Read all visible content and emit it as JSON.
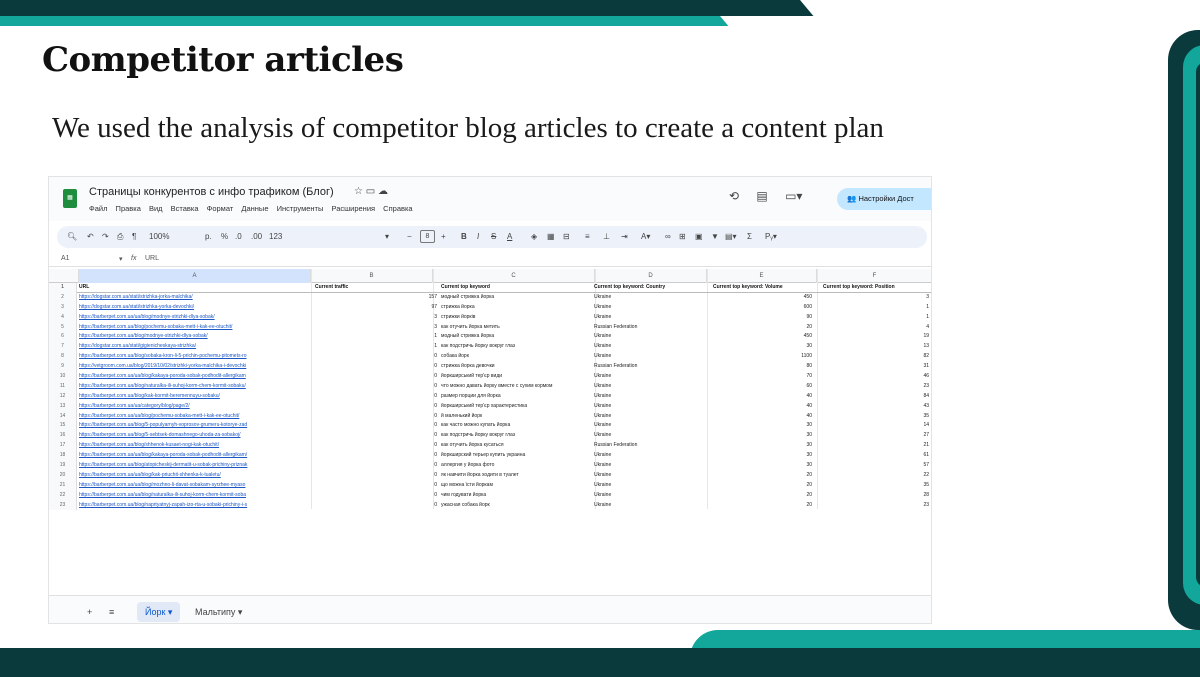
{
  "slide": {
    "title": "Competitor articles",
    "subtitle": "We used the analysis of competitor blog articles to create a content plan"
  },
  "sheet": {
    "doc_title": "Страницы конкурентов с инфо трафиком (Блог)",
    "menu": [
      "Файл",
      "Правка",
      "Вид",
      "Вставка",
      "Формат",
      "Данные",
      "Инструменты",
      "Расширения",
      "Справка"
    ],
    "share_label": "Настройки Дост",
    "zoom": "100%",
    "font_size": "8",
    "cell_ref": "A1",
    "formula": "URL",
    "col_letters": [
      "A",
      "B",
      "C",
      "D",
      "E",
      "F"
    ],
    "headers": [
      "URL",
      "Current traffic",
      "Current top keyword",
      "Current top keyword: Country",
      "Current top keyword: Volume",
      "Current top keyword: Position"
    ],
    "rows": [
      {
        "n": "2",
        "url": "https://dogstar.com.ua/stati/strizhka-jorka-malchika/",
        "traffic": "157",
        "kw": "модный стрижка йорка",
        "country": "Ukraine",
        "vol": "450",
        "pos": "3"
      },
      {
        "n": "3",
        "url": "https://dogstar.com.ua/stati/strizhka-yorka-devochki/",
        "traffic": "97",
        "kw": "стрижка йорка",
        "country": "Ukraine",
        "vol": "600",
        "pos": "1"
      },
      {
        "n": "4",
        "url": "https://barberpet.com.ua/ua/blog/modnye-strizhki-dlya-sobak/",
        "traffic": "3",
        "kw": "стрижки йорків",
        "country": "Ukraine",
        "vol": "90",
        "pos": "1"
      },
      {
        "n": "5",
        "url": "https://barberpet.com.ua/blog/pochemu-sobaka-mett-i-kak-ee-otuchit/",
        "traffic": "3",
        "kw": "как отучить йорка метить",
        "country": "Russian Federation",
        "vol": "20",
        "pos": "4"
      },
      {
        "n": "6",
        "url": "https://barberpet.com.ua/blog/modnye-strizhki-dlya-sobak/",
        "traffic": "1",
        "kw": "модный стрижка йорка",
        "country": "Ukraine",
        "vol": "450",
        "pos": "19"
      },
      {
        "n": "7",
        "url": "https://dogstar.com.ua/stati/gigienicheskaya-strizhka/",
        "traffic": "1",
        "kw": "как подстричь йорку вокруг глаз",
        "country": "Ukraine",
        "vol": "30",
        "pos": "13"
      },
      {
        "n": "8",
        "url": "https://barberpet.com.ua/blog/sobaka-kron-li-5-prichin-pochemu-pitomets-ro",
        "traffic": "0",
        "kw": "собака йорк",
        "country": "Ukraine",
        "vol": "1100",
        "pos": "82"
      },
      {
        "n": "9",
        "url": "https://vetgroom.com.ua/blog/2019/10/02/strizhki-yorka-malchika-i-devochki",
        "traffic": "0",
        "kw": "стрижка йорка девочки",
        "country": "Russian Federation",
        "vol": "80",
        "pos": "31"
      },
      {
        "n": "10",
        "url": "https://barberpet.com.ua/ua/blog/kakaya-poroda-sobak-podhodit-allergikam",
        "traffic": "0",
        "kw": "йоркширський тер'єр види",
        "country": "Ukraine",
        "vol": "70",
        "pos": "46"
      },
      {
        "n": "11",
        "url": "https://barberpet.com.ua/blog/naturalka-ili-suhoj-korm-chem-kormit-sobaku/",
        "traffic": "0",
        "kw": "что можно давать йорку вместе с сухим кормом",
        "country": "Ukraine",
        "vol": "60",
        "pos": "23"
      },
      {
        "n": "12",
        "url": "https://barberpet.com.ua/blog/kak-kormit-beremennuyu-sobaku/",
        "traffic": "0",
        "kw": "размер порции для йорка",
        "country": "Ukraine",
        "vol": "40",
        "pos": "84"
      },
      {
        "n": "13",
        "url": "https://barberpet.com.ua/ua/category/blog/page/2/",
        "traffic": "0",
        "kw": "йоркширський тер'єр характеристика",
        "country": "Ukraine",
        "vol": "40",
        "pos": "43"
      },
      {
        "n": "14",
        "url": "https://barberpet.com.ua/ua/blog/pochemu-sobaka-mett-i-kak-ee-otuchit/",
        "traffic": "0",
        "kw": "й маленький йорк",
        "country": "Ukraine",
        "vol": "40",
        "pos": "35"
      },
      {
        "n": "15",
        "url": "https://barberpet.com.ua/blog/5-populyarnyh-voprosov-grumeru-kotorye-zad",
        "traffic": "0",
        "kw": "как часто можно купать йорка",
        "country": "Ukraine",
        "vol": "30",
        "pos": "14"
      },
      {
        "n": "16",
        "url": "https://barberpet.com.ua/blog/5-sebtsek-domashnego-uhoda-za-sobakoj/",
        "traffic": "0",
        "kw": "как подстричь йорку вокруг глаз",
        "country": "Ukraine",
        "vol": "30",
        "pos": "27"
      },
      {
        "n": "17",
        "url": "https://barberpet.com.ua/blog/shhenok-kusaet-nogi-kak-otuchit/",
        "traffic": "0",
        "kw": "как отучить йорка кусаться",
        "country": "Russian Federation",
        "vol": "30",
        "pos": "21"
      },
      {
        "n": "18",
        "url": "https://barberpet.com.ua/ua/blog/kakaya-poroda-sobak-podhodit-allergikam/",
        "traffic": "0",
        "kw": "йоркширский терьер купить украина",
        "country": "Ukraine",
        "vol": "30",
        "pos": "61"
      },
      {
        "n": "19",
        "url": "https://barberpet.com.ua/blog/atopicheskij-dermatit-u-sobak-prichiny-priznak",
        "traffic": "0",
        "kw": "аллергия у йорка фото",
        "country": "Ukraine",
        "vol": "30",
        "pos": "57"
      },
      {
        "n": "20",
        "url": "https://barberpet.com.ua/ua/blog/kak-priuchit-shhenka-k-tualetu/",
        "traffic": "0",
        "kw": "як навчити йорка ходити в туалет",
        "country": "Ukraine",
        "vol": "20",
        "pos": "22"
      },
      {
        "n": "21",
        "url": "https://barberpet.com.ua/ua/blog/mozhno-li-davat-sobakam-syrzhee-myaso",
        "traffic": "0",
        "kw": "що можна їсти йоркам",
        "country": "Ukraine",
        "vol": "20",
        "pos": "35"
      },
      {
        "n": "22",
        "url": "https://barberpet.com.ua/ua/blog/naturalka-ili-suhoj-korm-chem-kormit-soba",
        "traffic": "0",
        "kw": "чим годувати йорка",
        "country": "Ukraine",
        "vol": "20",
        "pos": "28"
      },
      {
        "n": "23",
        "url": "https://barberpet.com.ua/blog/naprtyatnyj-zapah-izo-rta-u-sobaki-prichiny-i-s",
        "traffic": "0",
        "kw": "ужасная собака йорк",
        "country": "Ukraine",
        "vol": "20",
        "pos": "23"
      }
    ],
    "tabs": {
      "active": "Йорк",
      "other": "Мальтипу"
    }
  }
}
